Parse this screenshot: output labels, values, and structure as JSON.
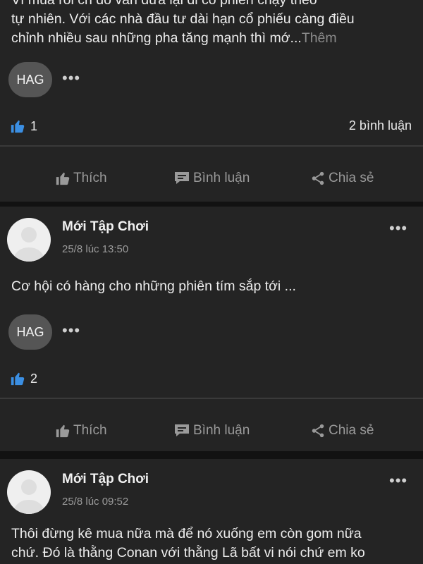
{
  "posts": [
    {
      "text_top_partial": "Vì mua rồi ch đó vẫn dữa lại đi có phiên chạy theo",
      "text_line1": "tự nhiên. Với các nhà đầu tư dài hạn cổ phiếu càng điều",
      "text_line2": "chỉnh nhiều sau những pha tăng mạnh thì mớ...",
      "more_label": "Thêm",
      "tag": "HAG",
      "likes": "1",
      "comments": "2 bình luận"
    },
    {
      "author": "Mới Tập Chơi",
      "time": "25/8 lúc 13:50",
      "text": "Cơ hội có hàng cho những phiên tím sắp tới ...",
      "tag": "HAG",
      "likes": "2"
    },
    {
      "author": "Mới Tập Chơi",
      "time": "25/8 lúc 09:52",
      "text_line1": "Thôi đừng kê mua nữa mà để nó xuống em còn gom nữa",
      "text_line2": "chứ. Đó là thằng Conan với thằng Lã bất vi nói chứ em ko"
    }
  ],
  "actions": {
    "like": "Thích",
    "comment": "Bình luận",
    "share": "Chia sẻ"
  },
  "colors": {
    "background": "#121212",
    "card": "#242424",
    "like_blue": "#3b8fe3",
    "muted": "#9a9a9a"
  }
}
